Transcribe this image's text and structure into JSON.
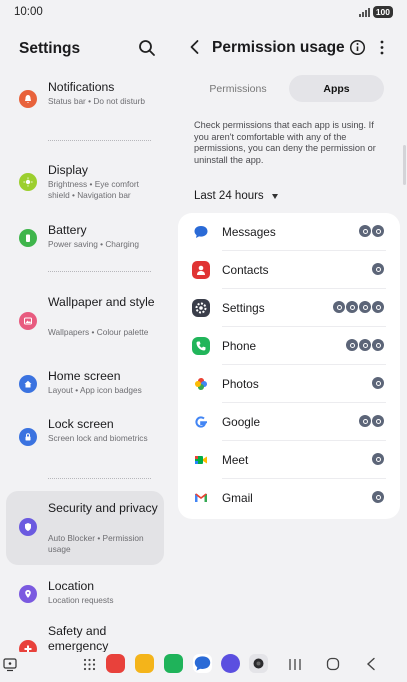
{
  "status": {
    "time": "10:00",
    "battery": "100"
  },
  "left": {
    "title": "Settings",
    "items": [
      {
        "title": "Notifications",
        "subtitle": "Status bar  •  Do not disturb",
        "color": "#e8623b",
        "icon": "bell-icon"
      },
      {
        "title": "Display",
        "subtitle": "Brightness  •  Eye comfort shield  •  Navigation bar",
        "color": "#9ccf2e",
        "icon": "sun-icon"
      },
      {
        "title": "Battery",
        "subtitle": "Power saving  •  Charging",
        "color": "#3fb54b",
        "icon": "battery-icon"
      },
      {
        "title": "Wallpaper and style",
        "subtitle": "Wallpapers  •  Colour palette",
        "color": "#e85b7f",
        "icon": "image-icon"
      },
      {
        "title": "Home screen",
        "subtitle": "Layout  •  App icon badges",
        "color": "#3b73e0",
        "icon": "home-icon"
      },
      {
        "title": "Lock screen",
        "subtitle": "Screen lock and biometrics",
        "color": "#3b73e0",
        "icon": "lock-icon"
      },
      {
        "title": "Security and privacy",
        "subtitle": "Auto Blocker  •  Permission usage",
        "color": "#6b5ae0",
        "icon": "shield-icon"
      },
      {
        "title": "Location",
        "subtitle": "Location requests",
        "color": "#7b5ae0",
        "icon": "location-pin-icon"
      },
      {
        "title": "Safety and emergency",
        "subtitle": "",
        "color": "#e8413b",
        "icon": "emergency-icon"
      }
    ]
  },
  "right": {
    "title": "Permission usage",
    "tabs": [
      "Permissions",
      "Apps"
    ],
    "description": "Check permissions that each app is using. If you aren't comfortable with any of the permissions, you can deny the permission or uninstall the app.",
    "range": "Last 24 hours",
    "apps": [
      {
        "name": "Messages",
        "icon": "messages-app-icon",
        "color": "#2a6ad6",
        "perms": 2
      },
      {
        "name": "Contacts",
        "icon": "contacts-app-icon",
        "color": "#e03434",
        "perms": 1
      },
      {
        "name": "Settings",
        "icon": "settings-app-icon",
        "color": "#3a3e4a",
        "perms": 4
      },
      {
        "name": "Phone",
        "icon": "phone-app-icon",
        "color": "#21b55a",
        "perms": 3
      },
      {
        "name": "Photos",
        "icon": "photos-app-icon",
        "color": "#f0a52b",
        "perms": 1
      },
      {
        "name": "Google",
        "icon": "google-app-icon",
        "color": "#4285f4",
        "perms": 2
      },
      {
        "name": "Meet",
        "icon": "meet-app-icon",
        "color": "#1f9e54",
        "perms": 1
      },
      {
        "name": "Gmail",
        "icon": "gmail-app-icon",
        "color": "#d93025",
        "perms": 1
      }
    ]
  },
  "dock": [
    {
      "icon": "notes-app-icon",
      "color": "#e8413b"
    },
    {
      "icon": "my-files-app-icon",
      "color": "#f4b41a"
    },
    {
      "icon": "phone-app-icon",
      "color": "#1fb35a"
    },
    {
      "icon": "messages-app-icon",
      "color": "#2a6ad6"
    },
    {
      "icon": "internet-app-icon",
      "color": "#5b4fe0"
    },
    {
      "icon": "camera-app-icon",
      "color": "#2b2b2e"
    }
  ]
}
